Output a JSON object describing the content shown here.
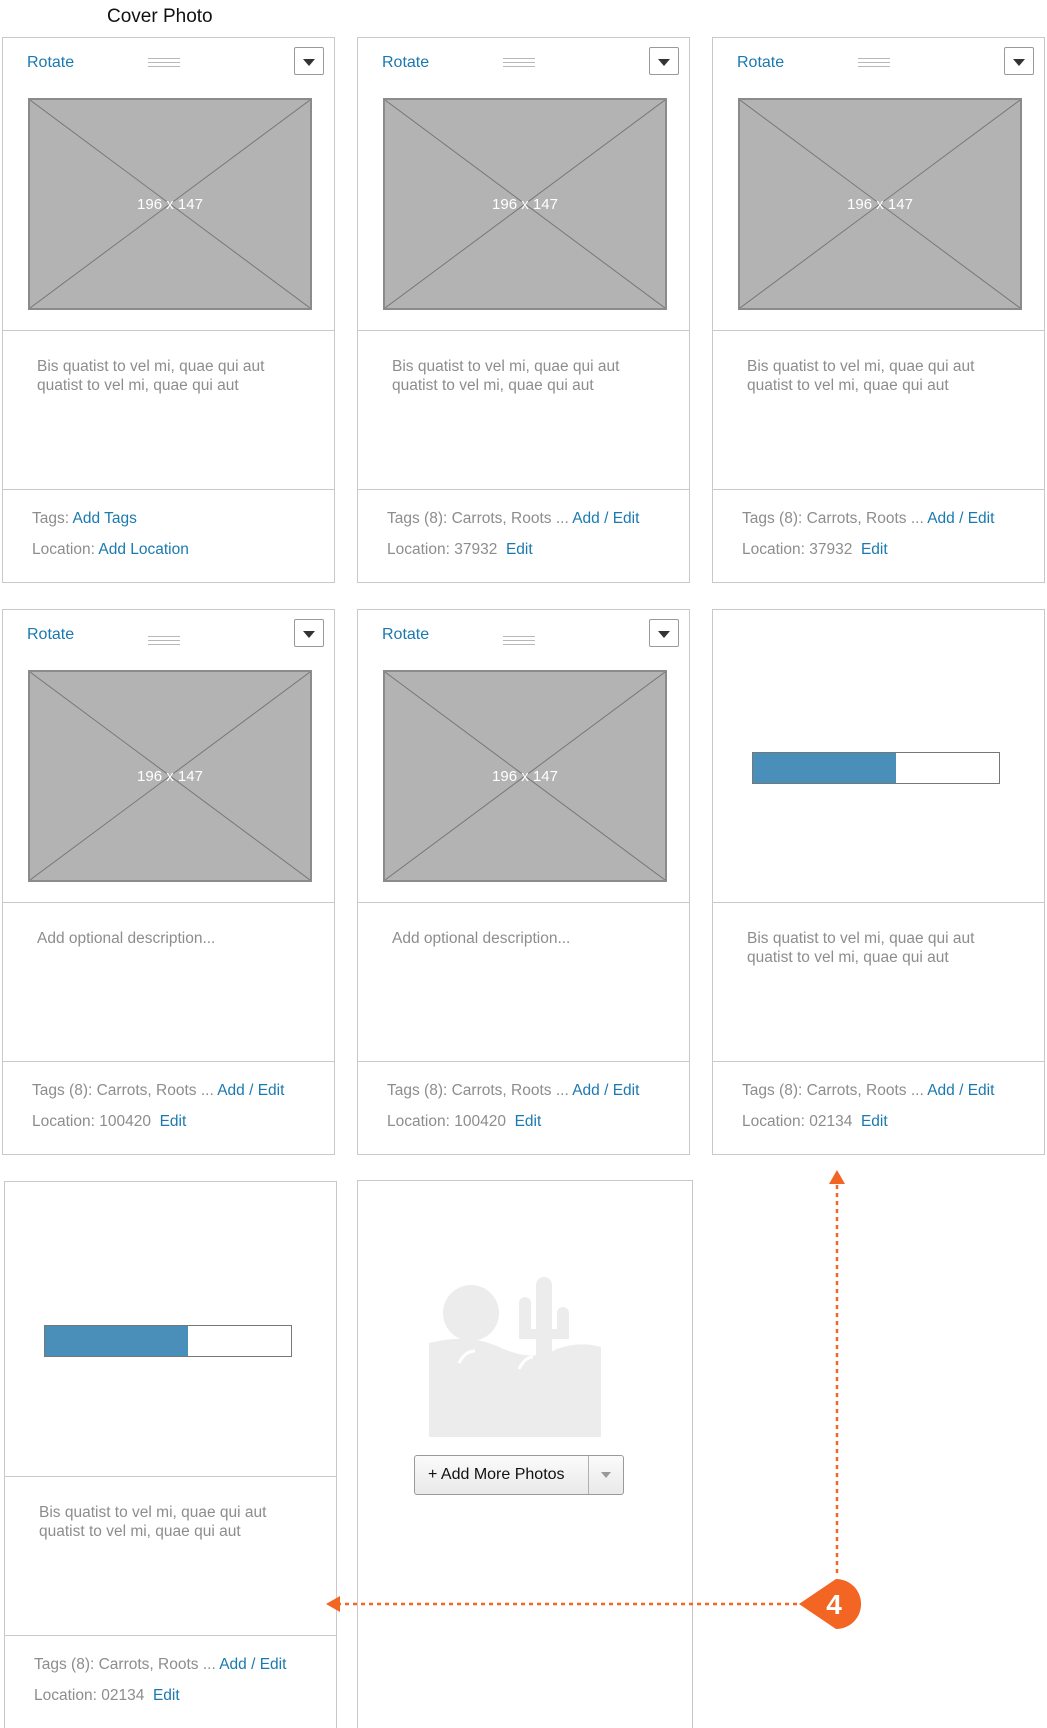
{
  "header": {
    "title": "Cover Photo"
  },
  "labels": {
    "rotate": "Rotate",
    "placeholder_size": "196 x 147",
    "location_prefix": "Location: ",
    "edit": "Edit",
    "add_edit": "Add / Edit"
  },
  "cards": [
    {
      "description": "Bis quatist to vel mi, quae qui aut quatist to vel mi, quae qui aut",
      "tags_text": "Tags: ",
      "tags_link": "Add Tags",
      "location_text": "Location: ",
      "location_link": "Add Location"
    },
    {
      "description": "Bis quatist to vel mi, quae qui aut quatist to vel mi, quae qui aut",
      "tags_text": "Tags (8): Carrots, Roots ... ",
      "tags_link": "Add / Edit",
      "location_value": "37932",
      "location_link": "Edit"
    },
    {
      "description": "Bis quatist to vel mi, quae qui aut quatist to vel mi, quae qui aut",
      "tags_text": "Tags (8): Carrots, Roots ... ",
      "tags_link": "Add / Edit",
      "location_value": "37932",
      "location_link": "Edit"
    },
    {
      "description": "Add optional description...",
      "tags_text": "Tags (8): Carrots, Roots ... ",
      "tags_link": "Add / Edit",
      "location_value": "100420",
      "location_link": "Edit"
    },
    {
      "description": "Add optional description...",
      "tags_text": "Tags (8): Carrots, Roots ... ",
      "tags_link": "Add / Edit",
      "location_value": "100420",
      "location_link": "Edit"
    },
    {
      "description": "Bis quatist to vel mi, quae qui aut quatist to vel mi, quae qui aut",
      "tags_text": "Tags (8): Carrots, Roots ... ",
      "tags_link": "Add / Edit",
      "location_value": "02134",
      "location_link": "Edit",
      "upload_progress": 0.58
    },
    {
      "description": "Bis quatist to vel mi, quae qui aut quatist to vel mi, quae qui aut",
      "tags_text": "Tags (8): Carrots, Roots ... ",
      "tags_link": "Add / Edit",
      "location_value": "02134",
      "location_link": "Edit",
      "upload_progress": 0.58
    }
  ],
  "add_more": {
    "button_label": "+ Add More Photos",
    "icon": "landscape-placeholder-icon"
  },
  "annotation": {
    "number": "4",
    "color": "#f26522"
  },
  "colors": {
    "link": "#1a79b0",
    "progress": "#4a8fba",
    "placeholder": "#b3b3b3"
  }
}
